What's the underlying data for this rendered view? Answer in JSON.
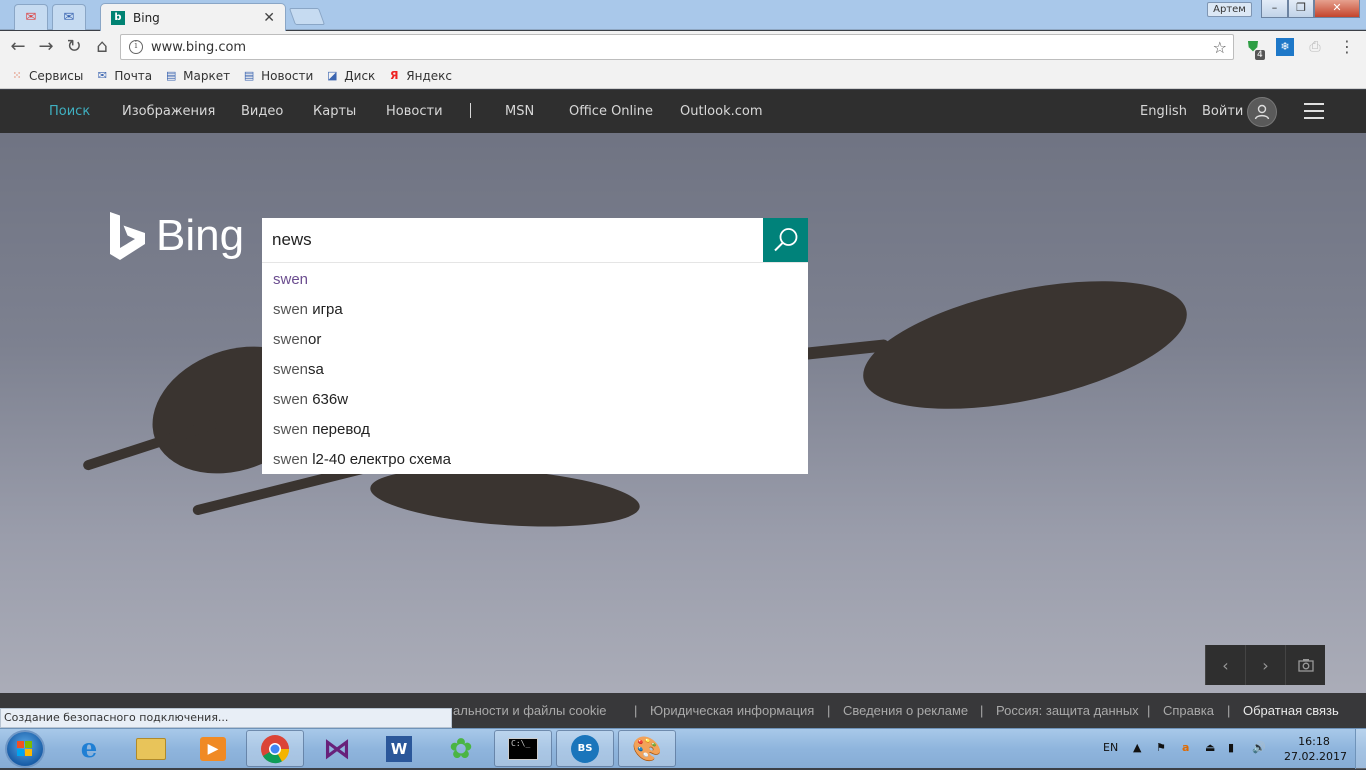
{
  "browser": {
    "active_tab_title": "Bing",
    "profile_name": "Артем",
    "url": "www.bing.com",
    "extension_badge": "4",
    "bookmarks": [
      {
        "label": "Сервисы",
        "icon": "apps-grid-icon"
      },
      {
        "label": "Почта",
        "icon": "mail-icon"
      },
      {
        "label": "Маркет",
        "icon": "market-icon"
      },
      {
        "label": "Новости",
        "icon": "news-icon"
      },
      {
        "label": "Диск",
        "icon": "disk-icon"
      },
      {
        "label": "Яндекс",
        "icon": "yandex-icon"
      }
    ]
  },
  "bing": {
    "nav": {
      "items": [
        "Поиск",
        "Изображения",
        "Видео",
        "Карты",
        "Новости",
        "MSN",
        "Office Online",
        "Outlook.com"
      ],
      "language": "English",
      "signin": "Войти"
    },
    "logo_text": "Bing",
    "search": {
      "query": "news"
    },
    "suggestions": [
      {
        "prefix": "swen",
        "rest": ""
      },
      {
        "prefix": "swen",
        "rest": " игра"
      },
      {
        "prefix": "swen",
        "rest": "or"
      },
      {
        "prefix": "swen",
        "rest": "sa"
      },
      {
        "prefix": "swen",
        "rest": " 636w"
      },
      {
        "prefix": "swen",
        "rest": " перевод"
      },
      {
        "prefix": "swen",
        "rest": " l2-40 електро схема"
      }
    ],
    "footer": {
      "links": [
        "альности и файлы cookie",
        "Юридическая информация",
        "Сведения о рекламе",
        "Россия: защита данных",
        "Справка",
        "Обратная связь"
      ]
    },
    "status_text": "Создание безопасного подключения..."
  },
  "taskbar": {
    "language": "EN",
    "time": "16:18",
    "date": "27.02.2017"
  },
  "colors": {
    "bing_teal": "#00827a",
    "nav_active": "#3fb0c1",
    "nav_bg": "#2f2f2f"
  }
}
